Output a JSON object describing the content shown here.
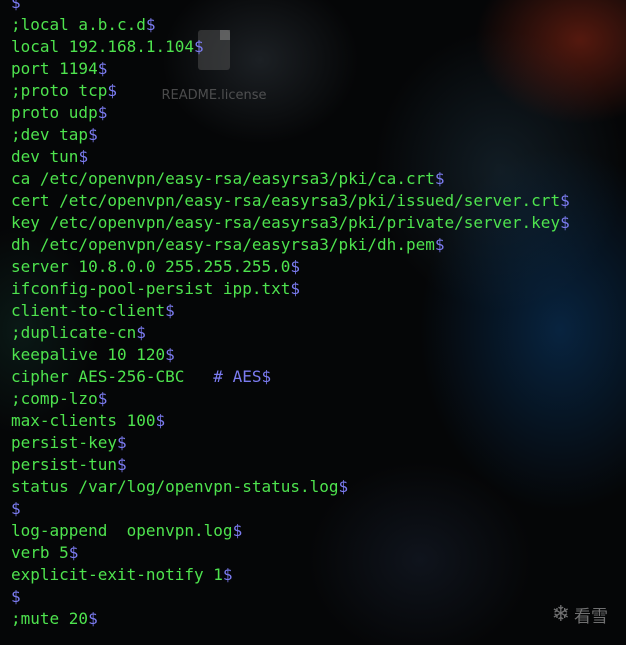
{
  "desktop": {
    "file_label": "README.license"
  },
  "watermark": {
    "text": "看雪"
  },
  "terminal": {
    "eol": "$",
    "lines": [
      "",
      ";local a.b.c.d",
      "local 192.168.1.104",
      "port 1194",
      ";proto tcp",
      "proto udp",
      ";dev tap",
      "dev tun",
      "ca /etc/openvpn/easy-rsa/easyrsa3/pki/ca.crt",
      "cert /etc/openvpn/easy-rsa/easyrsa3/pki/issued/server.crt",
      "key /etc/openvpn/easy-rsa/easyrsa3/pki/private/server.key",
      "dh /etc/openvpn/easy-rsa/easyrsa3/pki/dh.pem",
      "server 10.8.0.0 255.255.255.0",
      "ifconfig-pool-persist ipp.txt",
      "client-to-client",
      ";duplicate-cn",
      "keepalive 10 120",
      "cipher AES-256-CBC   ",
      ";comp-lzo",
      "max-clients 100",
      "persist-key",
      "persist-tun",
      "status /var/log/openvpn-status.log",
      "",
      "log-append  openvpn.log",
      "verb 5",
      "explicit-exit-notify 1",
      "",
      ";mute 20"
    ],
    "cipher_comment": "# AES"
  }
}
